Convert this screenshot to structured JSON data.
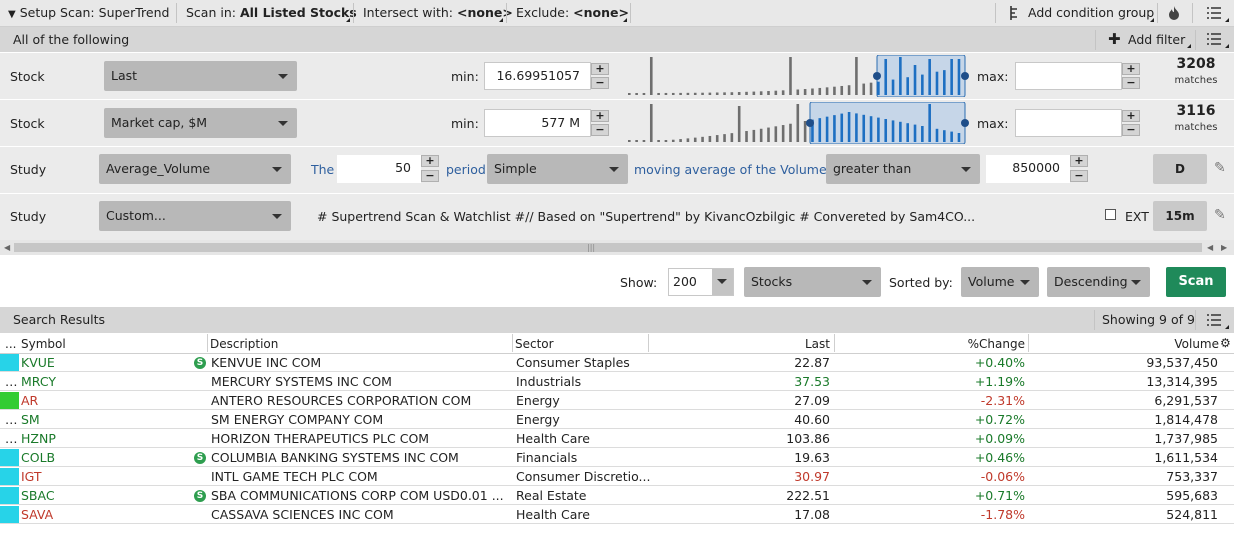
{
  "toolbar": {
    "setup_prefix": "Setup Scan:",
    "setup_name": "SuperTrend",
    "scan_in_label": "Scan in:",
    "scan_in_value": "All Listed Stocks",
    "intersect_label": "Intersect with:",
    "intersect_value": "<none>",
    "exclude_label": "Exclude:",
    "exclude_value": "<none>",
    "add_condition_group": "Add condition group"
  },
  "filter_header": {
    "title": "All of the following",
    "add_filter": "Add filter"
  },
  "filters": [
    {
      "type": "Stock",
      "field": "Last",
      "min_label": "min:",
      "min": "16.69951057",
      "max_label": "max:",
      "max": "",
      "matches_count": "3208",
      "matches_label": "matches"
    },
    {
      "type": "Stock",
      "field": "Market cap, $M",
      "min_label": "min:",
      "min": "577 M",
      "max_label": "max:",
      "max": "",
      "matches_count": "3116",
      "matches_label": "matches"
    }
  ],
  "study1": {
    "type": "Study",
    "name": "Average_Volume",
    "the": "The",
    "length": "50",
    "period": "period",
    "avg_type": "Simple",
    "text": "moving average of the Volume is",
    "condition": "greater than",
    "value": "850000",
    "aggregation": "D"
  },
  "study2": {
    "type": "Study",
    "name": "Custom...",
    "code": "# Supertrend Scan & Watchlist #// Based on \"Supertrend\" by KivancOzbilgic  # Convereted by Sam4CO...",
    "ext": "EXT",
    "aggregation": "15m"
  },
  "scan_bar": {
    "show_label": "Show:",
    "show_value": "200",
    "type_value": "Stocks",
    "sorted_label": "Sorted by:",
    "sort_field": "Volume",
    "sort_order": "Descending",
    "scan_button": "Scan"
  },
  "results": {
    "title": "Search Results",
    "showing": "Showing 9 of 9",
    "columns": [
      "...",
      "Symbol",
      "Description",
      "Sector",
      "Last",
      "%Change",
      "Volume"
    ],
    "rows": [
      {
        "symbol": "KVUE",
        "desc": "KENVUE INC COM",
        "sector": "Consumer Staples",
        "last": "22.87",
        "change": "+0.40%",
        "volume": "93,537,450",
        "dir": "up",
        "flag": "#27d3e8",
        "s": true,
        "last_color": "neutral"
      },
      {
        "symbol": "MRCY",
        "desc": "MERCURY SYSTEMS INC COM",
        "sector": "Industrials",
        "last": "37.53",
        "change": "+1.19%",
        "volume": "13,314,395",
        "dir": "up",
        "flag": "",
        "s": false,
        "last_color": "green"
      },
      {
        "symbol": "AR",
        "desc": "ANTERO RESOURCES CORPORATION COM",
        "sector": "Energy",
        "last": "27.09",
        "change": "-2.31%",
        "volume": "6,291,537",
        "dir": "down",
        "flag": "#33cc33",
        "s": false,
        "last_color": "neutral"
      },
      {
        "symbol": "SM",
        "desc": "SM ENERGY COMPANY COM",
        "sector": "Energy",
        "last": "40.60",
        "change": "+0.72%",
        "volume": "1,814,478",
        "dir": "up",
        "flag": "",
        "s": false,
        "last_color": "neutral"
      },
      {
        "symbol": "HZNP",
        "desc": "HORIZON THERAPEUTICS PLC COM",
        "sector": "Health Care",
        "last": "103.86",
        "change": "+0.09%",
        "volume": "1,737,985",
        "dir": "up",
        "flag": "",
        "s": false,
        "last_color": "neutral"
      },
      {
        "symbol": "COLB",
        "desc": "COLUMBIA BANKING SYSTEMS INC COM",
        "sector": "Financials",
        "last": "19.63",
        "change": "+0.46%",
        "volume": "1,611,534",
        "dir": "up",
        "flag": "#27d3e8",
        "s": true,
        "last_color": "neutral"
      },
      {
        "symbol": "IGT",
        "desc": "INTL GAME TECH PLC COM",
        "sector": "Consumer Discretio...",
        "last": "30.97",
        "change": "-0.06%",
        "volume": "753,337",
        "dir": "down",
        "flag": "#27d3e8",
        "s": false,
        "last_color": "red"
      },
      {
        "symbol": "SBAC",
        "desc": "SBA COMMUNICATIONS CORP COM USD0.01 ...",
        "sector": "Real Estate",
        "last": "222.51",
        "change": "+0.71%",
        "volume": "595,683",
        "dir": "up",
        "flag": "#27d3e8",
        "s": true,
        "last_color": "neutral"
      },
      {
        "symbol": "SAVA",
        "desc": "CASSAVA SCIENCES INC COM",
        "sector": "Health Care",
        "last": "17.08",
        "change": "-1.78%",
        "volume": "524,811",
        "dir": "down",
        "flag": "#27d3e8",
        "s": false,
        "last_color": "neutral"
      }
    ]
  },
  "colors": {
    "up": "#1a7a2a",
    "down": "#c0392b",
    "scan_button": "#1f8a5a",
    "flag_cyan": "#27d3e8",
    "flag_green": "#33cc33"
  },
  "icons": [
    "chevron-down-icon",
    "condition-group-icon",
    "fire-icon",
    "menu-icon",
    "plus-icon",
    "pencil-icon",
    "gear-icon",
    "s-badge-icon"
  ]
}
